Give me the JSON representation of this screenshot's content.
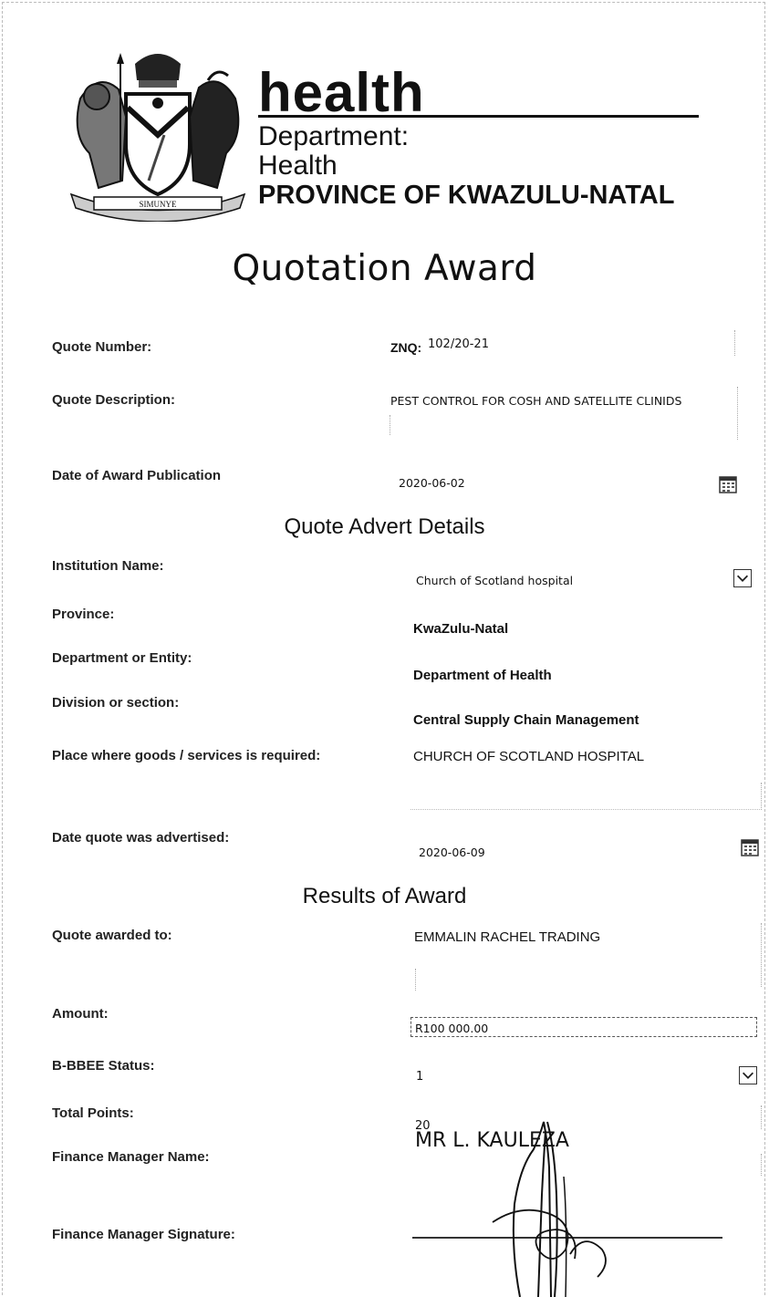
{
  "header": {
    "brand": "health",
    "department_label": "Department:",
    "department_name": "Health",
    "province": "PROVINCE OF KWAZULU-NATAL",
    "crest_motto": "SIMUNYE"
  },
  "title": "Quotation Award",
  "quote_info": {
    "number_label": "Quote Number:",
    "number_prefix": "ZNQ:",
    "number_value": "102/20-21",
    "description_label": "Quote Description:",
    "description_value": "PEST CONTROL FOR COSH AND SATELLITE CLINIDS",
    "award_date_label": "Date of Award Publication",
    "award_date_value": "2020-06-02"
  },
  "advert": {
    "heading": "Quote Advert Details",
    "institution_label": "Institution Name:",
    "institution_value": "Church of Scotland hospital",
    "province_label": "Province:",
    "province_value": "KwaZulu-Natal",
    "department_label": "Department or Entity:",
    "department_value": "Department of Health",
    "division_label": "Division or section:",
    "division_value": "Central Supply Chain Management",
    "place_label": "Place where goods /  services is required:",
    "place_value": "CHURCH OF SCOTLAND HOSPITAL",
    "advertised_label": "Date quote was advertised:",
    "advertised_value": "2020-06-09"
  },
  "results": {
    "heading": "Results of Award",
    "awarded_label": "Quote awarded to:",
    "awarded_value": "EMMALIN RACHEL TRADING",
    "amount_label": "Amount:",
    "amount_value": "R100 000.00",
    "bbbee_label": "B-BBEE Status:",
    "bbbee_value": "1",
    "points_label": "Total Points:",
    "points_value": "20",
    "fm_name_label": "Finance Manager Name:",
    "fm_name_value": "MR L. KAULEZA",
    "fm_signature_label": "Finance Manager Signature:"
  },
  "icons": {
    "dropdown": "chevron-down-icon",
    "calendar": "calendar-icon",
    "crest": "coat-of-arms-icon",
    "signature": "signature-icon"
  }
}
